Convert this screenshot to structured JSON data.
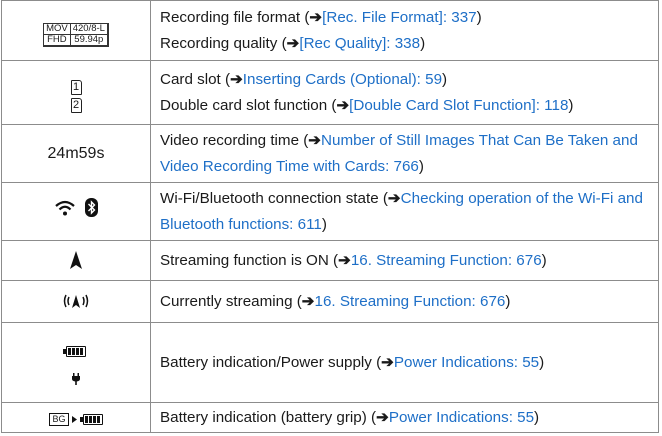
{
  "arrow": "➔",
  "rows": [
    {
      "icon": "mov-420-fhd-icon",
      "icon_text": {
        "a": "MOV",
        "b": "420/8-L",
        "c": "FHD",
        "d": "59.94p"
      },
      "lines": [
        {
          "pre": "Recording file format (",
          "link": "[Rec. File Format]: 337",
          "post": ")"
        },
        {
          "pre": "Recording quality (",
          "link": "[Rec Quality]: 338",
          "post": ")"
        }
      ]
    },
    {
      "icon": "card-slot-icon",
      "icon_text": {
        "a": "1",
        "b": "2"
      },
      "lines": [
        {
          "pre": "Card slot (",
          "link": "Inserting Cards (Optional): 59",
          "post": ")"
        },
        {
          "pre": "Double card slot function (",
          "link": "[Double Card Slot Function]: 118",
          "post": ")"
        }
      ]
    },
    {
      "icon": "recording-time-text",
      "icon_text": {
        "a": "24m59s"
      },
      "lines": [
        {
          "pre": "Video recording time (",
          "link": "Number of Still Images That Can Be Taken and Video Recording Time with Cards: 766",
          "post": ")"
        }
      ]
    },
    {
      "icon": "wifi-bluetooth-icon",
      "lines": [
        {
          "pre": "Wi-Fi/Bluetooth connection state (",
          "link": "Checking operation of the Wi-Fi and Bluetooth functions: 611",
          "post": ")"
        }
      ]
    },
    {
      "icon": "streaming-on-icon",
      "lines": [
        {
          "pre": "Streaming function is ON (",
          "link": "16. Streaming Function: 676",
          "post": ")"
        }
      ]
    },
    {
      "icon": "currently-streaming-icon",
      "lines": [
        {
          "pre": "Currently streaming (",
          "link": "16. Streaming Function: 676",
          "post": ")"
        }
      ]
    },
    {
      "icon": "battery-power-icon",
      "lines": [
        {
          "pre": "Battery indication/Power supply (",
          "link": "Power Indications: 55",
          "post": ")"
        }
      ]
    },
    {
      "icon": "battery-grip-icon",
      "icon_text": {
        "a": "BG"
      },
      "lines": [
        {
          "pre": "Battery indication (battery grip) (",
          "link": "Power Indications: 55",
          "post": ")"
        }
      ]
    }
  ],
  "colors": {
    "link": "#1e6fc7",
    "border": "#8c8c8c",
    "text": "#1a1a1a"
  }
}
